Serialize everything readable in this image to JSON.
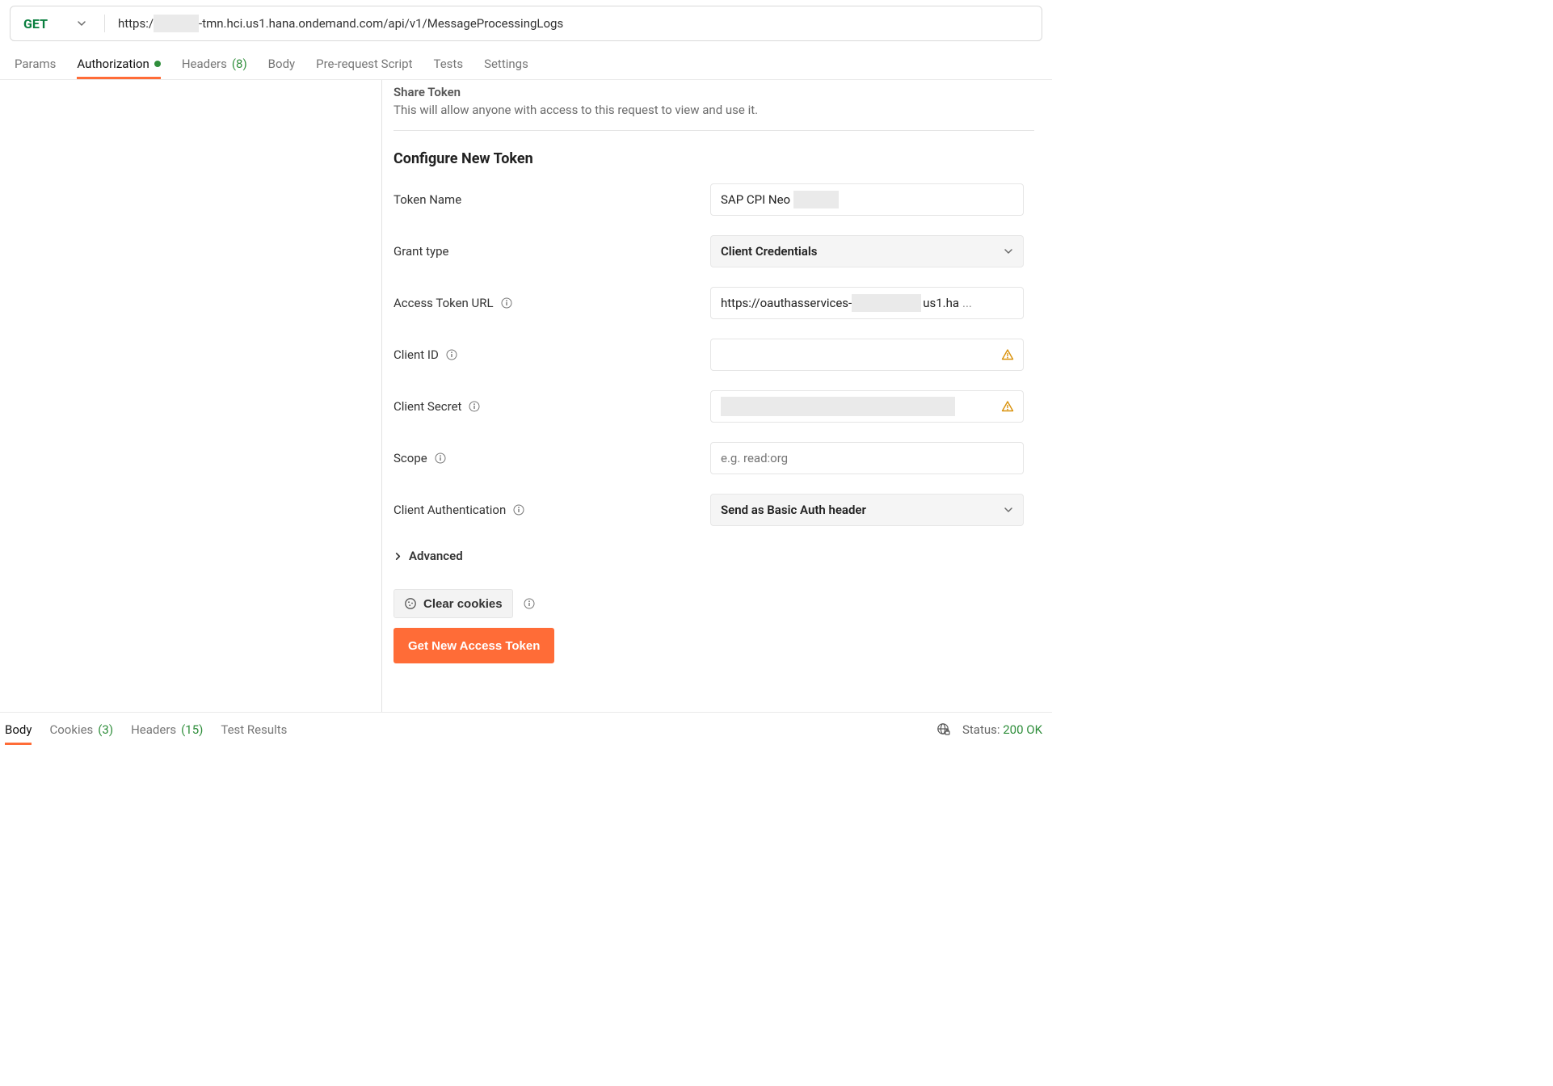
{
  "request": {
    "method": "GET",
    "url_prefix": "https:/",
    "url_suffix": "-tmn.hci.us1.hana.ondemand.com/api/v1/MessageProcessingLogs"
  },
  "top_tabs": {
    "params": "Params",
    "authorization": "Authorization",
    "headers_label": "Headers",
    "headers_count": "(8)",
    "body": "Body",
    "prerequest": "Pre-request Script",
    "tests": "Tests",
    "settings": "Settings"
  },
  "share_token": {
    "title": "Share Token",
    "desc": "This will allow anyone with access to this request to view and use it."
  },
  "configure": {
    "heading": "Configure New Token",
    "token_name_label": "Token Name",
    "token_name_value": "SAP CPI Neo",
    "grant_type_label": "Grant type",
    "grant_type_value": "Client Credentials",
    "access_token_url_label": "Access Token URL",
    "access_token_url_prefix": "https://oauthasservices-",
    "access_token_url_suffix": "us1.ha",
    "access_token_url_ellipsis": "...",
    "client_id_label": "Client ID",
    "client_secret_label": "Client Secret",
    "scope_label": "Scope",
    "scope_placeholder": "e.g. read:org",
    "client_auth_label": "Client Authentication",
    "client_auth_value": "Send as Basic Auth header",
    "advanced": "Advanced",
    "clear_cookies": "Clear cookies",
    "get_token": "Get New Access Token"
  },
  "bottom_tabs": {
    "body": "Body",
    "cookies_label": "Cookies",
    "cookies_count": "(3)",
    "headers_label": "Headers",
    "headers_count": "(15)",
    "test_results": "Test Results"
  },
  "status": {
    "label": "Status:",
    "value": "200 OK"
  }
}
